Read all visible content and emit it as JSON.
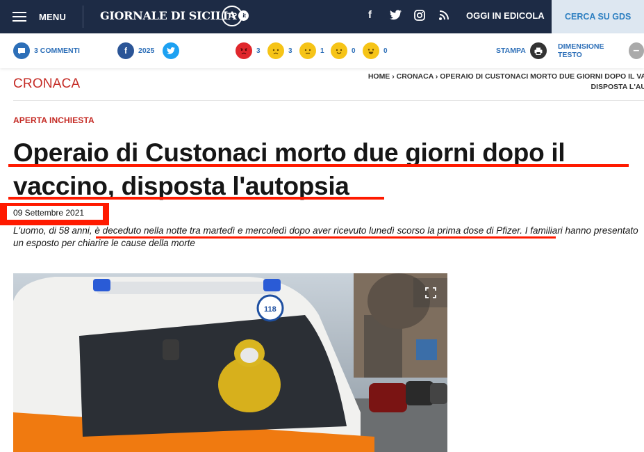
{
  "header": {
    "menu_label": "MENU",
    "logo_text": "GIORNALE DI SICILIA",
    "logo_badge": ".it",
    "province_badge": "TP",
    "social": {
      "facebook": "f",
      "rss": "RSS"
    },
    "edicola_label": "OGGI IN EDICOLA",
    "cerca_label": "CERCA SU GDS"
  },
  "toolbar": {
    "comments_label": "3 COMMENTI",
    "facebook_count": "2025",
    "reactions": [
      {
        "icon": "angry-face-icon",
        "color": "#e0272c",
        "count": "3"
      },
      {
        "icon": "sad-face-icon",
        "color": "#f6c417",
        "count": "3"
      },
      {
        "icon": "neutral-face-icon",
        "color": "#f6c417",
        "count": "1"
      },
      {
        "icon": "smile-face-icon",
        "color": "#f6c417",
        "count": "0"
      },
      {
        "icon": "laugh-face-icon",
        "color": "#f6c417",
        "count": "0"
      }
    ],
    "print_label": "STAMPA",
    "text_size_label": "DIMENSIONE TESTO"
  },
  "article": {
    "section": "CRONACA",
    "breadcrumb_line1": "HOME › CRONACA › OPERAIO DI CUSTONACI MORTO DUE GIORNI DOPO IL VA",
    "breadcrumb_line2": "DISPOSTA L'AU",
    "kicker": "APERTA INCHIESTA",
    "headline": "Operaio di Custonaci morto due giorni dopo il vaccino, disposta l'autopsia",
    "date": "09 Settembre 2021",
    "summary_a": "L'uomo, di 58 anni, ",
    "summary_b": "è deceduto nella notte tra martedì e mercoledì dopo aver ricevuto lunedì scorso la prima dose di Pfizer.",
    "summary_c": " I familiari hanno presentato un esposto per chiarire le cause della morte"
  },
  "colors": {
    "header_bg": "#1d2b45",
    "accent_red": "#c52c26",
    "link_blue": "#2d6fb8",
    "annotation_red": "#ff1a00"
  }
}
